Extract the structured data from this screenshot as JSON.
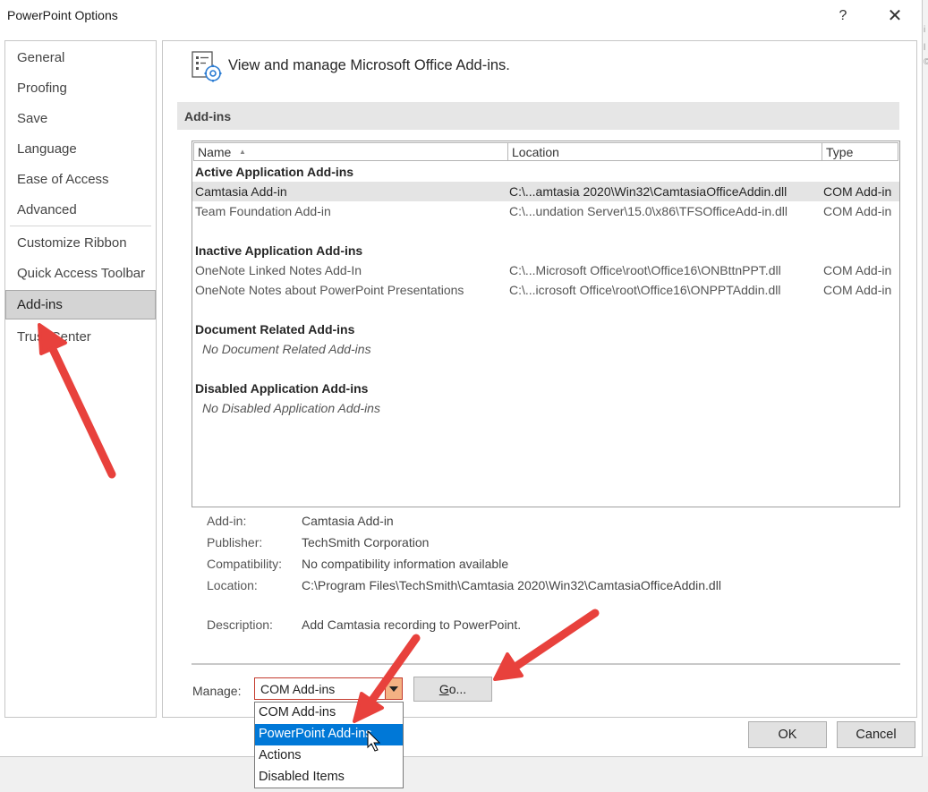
{
  "window": {
    "title": "PowerPoint Options",
    "help": "?",
    "close": "✕"
  },
  "bg_strip": [
    "i",
    "l",
    "©"
  ],
  "sidebar": {
    "items": [
      {
        "label": "General"
      },
      {
        "label": "Proofing"
      },
      {
        "label": "Save"
      },
      {
        "label": "Language"
      },
      {
        "label": "Ease of Access"
      },
      {
        "label": "Advanced"
      },
      {
        "label": "Customize Ribbon"
      },
      {
        "label": "Quick Access Toolbar"
      },
      {
        "label": "Add-ins"
      },
      {
        "label": "Trust Center"
      }
    ],
    "selected": "Add-ins"
  },
  "main": {
    "header": "View and manage Microsoft Office Add-ins.",
    "section_title": "Add-ins",
    "columns": {
      "name": "Name",
      "location": "Location",
      "type": "Type"
    },
    "groups": {
      "active": "Active Application Add-ins",
      "inactive": "Inactive Application Add-ins",
      "document": "Document Related Add-ins",
      "disabled": "Disabled Application Add-ins"
    },
    "active_rows": [
      {
        "name": "Camtasia Add-in",
        "location": "C:\\...amtasia 2020\\Win32\\CamtasiaOfficeAddin.dll",
        "type": "COM Add-in"
      },
      {
        "name": "Team Foundation Add-in",
        "location": "C:\\...undation Server\\15.0\\x86\\TFSOfficeAdd-in.dll",
        "type": "COM Add-in"
      }
    ],
    "inactive_rows": [
      {
        "name": "OneNote Linked Notes Add-In",
        "location": "C:\\...Microsoft Office\\root\\Office16\\ONBttnPPT.dll",
        "type": "COM Add-in"
      },
      {
        "name": "OneNote Notes about PowerPoint Presentations",
        "location": "C:\\...icrosoft Office\\root\\Office16\\ONPPTAddin.dll",
        "type": "COM Add-in"
      }
    ],
    "document_empty": "No Document Related Add-ins",
    "disabled_empty": "No Disabled Application Add-ins",
    "details": {
      "addin_label": "Add-in:",
      "addin_value": "Camtasia Add-in",
      "publisher_label": "Publisher:",
      "publisher_value": "TechSmith Corporation",
      "compat_label": "Compatibility:",
      "compat_value": "No compatibility information available",
      "location_label": "Location:",
      "location_value": "C:\\Program Files\\TechSmith\\Camtasia 2020\\Win32\\CamtasiaOfficeAddin.dll",
      "desc_label": "Description:",
      "desc_value": "Add Camtasia recording to PowerPoint."
    },
    "manage": {
      "label": "Manage:",
      "selected": "COM Add-ins",
      "go_prefix": "G",
      "go_rest": "o...",
      "options": [
        "COM Add-ins",
        "PowerPoint Add-ins",
        "Actions",
        "Disabled Items"
      ],
      "highlighted": "PowerPoint Add-ins"
    }
  },
  "footer": {
    "ok": "OK",
    "cancel": "Cancel"
  },
  "colors": {
    "accent": "#0078d7",
    "arrow": "#e8413c",
    "dropdown_arrow_bg": "#f4b183"
  }
}
